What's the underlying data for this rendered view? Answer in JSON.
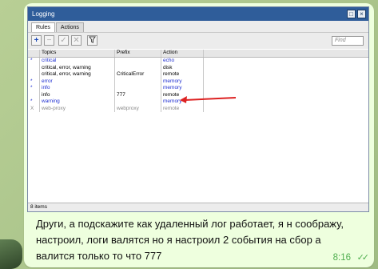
{
  "window": {
    "title": "Logging",
    "tabs": [
      "Rules",
      "Actions"
    ],
    "find_placeholder": "Find",
    "columns": [
      "Topics",
      "Prefix",
      "Action"
    ],
    "rows": [
      {
        "flag": "*",
        "topics": "critical",
        "prefix": "",
        "action": "echo",
        "style": "blue"
      },
      {
        "flag": "",
        "topics": "critical, error, warning",
        "prefix": "",
        "action": "disk",
        "style": "normal"
      },
      {
        "flag": "",
        "topics": "critical, error, warning",
        "prefix": "CriticalError",
        "action": "remote",
        "style": "normal"
      },
      {
        "flag": "*",
        "topics": "error",
        "prefix": "",
        "action": "memory",
        "style": "blue"
      },
      {
        "flag": "*",
        "topics": "info",
        "prefix": "",
        "action": "memory",
        "style": "blue"
      },
      {
        "flag": "",
        "topics": "info",
        "prefix": "777",
        "action": "remote",
        "style": "normal"
      },
      {
        "flag": "*",
        "topics": "warning",
        "prefix": "",
        "action": "memory",
        "style": "blue"
      },
      {
        "flag": "X",
        "topics": "web-proxy",
        "prefix": "webproxy",
        "action": "remote",
        "style": "gray"
      }
    ],
    "status": "8 items"
  },
  "message": {
    "lines": [
      "Други, а подскажите как удаленный лог работает, я н соображу,",
      "настроил, логи валятся но я настроил 2 события на сбор а",
      "валится только то что 777"
    ],
    "time": "8:16"
  },
  "colors": {
    "accent": "#2f5d9a",
    "bubble": "#eeffde",
    "check": "#4fae4e"
  }
}
